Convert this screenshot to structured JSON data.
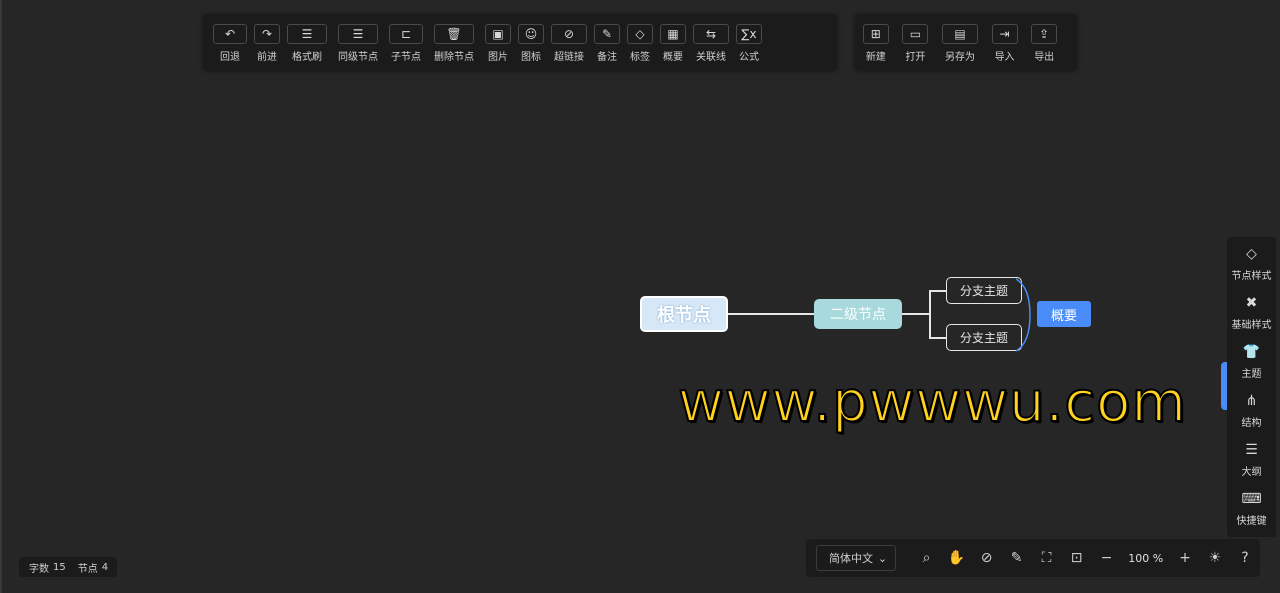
{
  "toolbar_main": [
    {
      "label": "回退",
      "icon": "undo-icon",
      "glyph": "↶"
    },
    {
      "label": "前进",
      "icon": "redo-icon",
      "glyph": "↷"
    },
    {
      "label": "格式刷",
      "icon": "format-brush-icon",
      "glyph": "☰"
    },
    {
      "label": "同级节点",
      "icon": "sibling-node-icon",
      "glyph": "☰"
    },
    {
      "label": "子节点",
      "icon": "child-node-icon",
      "glyph": "⊏"
    },
    {
      "label": "删除节点",
      "icon": "trash-icon",
      "glyph": "🗑"
    },
    {
      "label": "图片",
      "icon": "image-icon",
      "glyph": "▣"
    },
    {
      "label": "图标",
      "icon": "smiley-icon",
      "glyph": "☺"
    },
    {
      "label": "超链接",
      "icon": "link-icon",
      "glyph": "⊘"
    },
    {
      "label": "备注",
      "icon": "note-icon",
      "glyph": "✎"
    },
    {
      "label": "标签",
      "icon": "tag-icon",
      "glyph": "◇"
    },
    {
      "label": "概要",
      "icon": "summary-icon",
      "glyph": "▦"
    },
    {
      "label": "关联线",
      "icon": "association-line-icon",
      "glyph": "⇆"
    },
    {
      "label": "公式",
      "icon": "formula-icon",
      "glyph": "∑x"
    }
  ],
  "toolbar_file": [
    {
      "label": "新建",
      "icon": "new-file-icon",
      "glyph": "⊞"
    },
    {
      "label": "打开",
      "icon": "folder-open-icon",
      "glyph": "▭"
    },
    {
      "label": "另存为",
      "icon": "save-as-icon",
      "glyph": "▤"
    },
    {
      "label": "导入",
      "icon": "import-icon",
      "glyph": "⇥"
    },
    {
      "label": "导出",
      "icon": "export-icon",
      "glyph": "⇪"
    }
  ],
  "mindmap": {
    "root": "根节点",
    "second": "二级节点",
    "branches": [
      "分支主题",
      "分支主题"
    ],
    "summary": "概要"
  },
  "watermark": "www.pwwwu.com",
  "sidebar": [
    {
      "label": "节点样式",
      "icon": "node-style-icon",
      "glyph": "◇"
    },
    {
      "label": "基础样式",
      "icon": "basic-style-icon",
      "glyph": "✖"
    },
    {
      "label": "主题",
      "icon": "shirt-icon",
      "glyph": "👕"
    },
    {
      "label": "结构",
      "icon": "structure-icon",
      "glyph": "⋔"
    },
    {
      "label": "大纲",
      "icon": "outline-icon",
      "glyph": "☰"
    },
    {
      "label": "快捷键",
      "icon": "keyboard-icon",
      "glyph": "⌨"
    }
  ],
  "status": {
    "word_count_label": "字数",
    "word_count": "15",
    "node_count_label": "节点",
    "node_count": "4"
  },
  "bottombar": {
    "language": "简体中文",
    "zoom": "100",
    "zoom_unit": "%",
    "icons": {
      "search": "⌕",
      "hand": "✋",
      "navigator": "⊘",
      "edit": "✎",
      "fit": "⛶",
      "fullscreen": "⊡",
      "zoom_out": "−",
      "zoom_in": "+",
      "theme": "☀",
      "help": "?"
    }
  },
  "colors": {
    "accent": "#4a8cf7",
    "background": "#262626",
    "panel": "#1b1b1b"
  }
}
